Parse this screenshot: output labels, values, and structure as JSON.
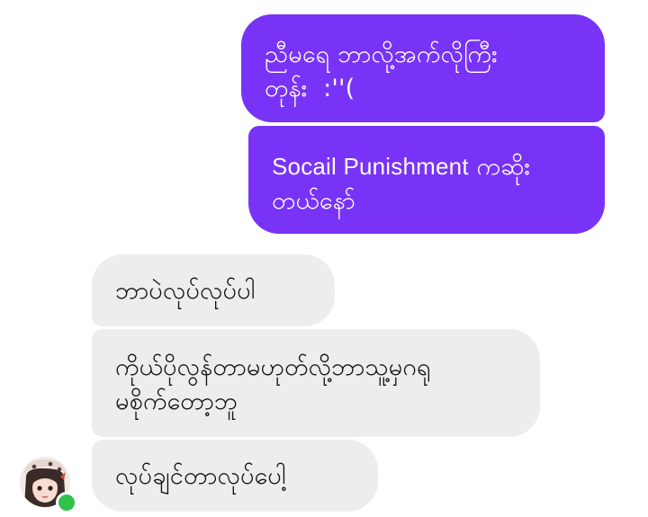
{
  "messages": [
    {
      "direction": "outgoing",
      "text": "ညီမရေ ဘာလို့အက်လိုကြီး\nတုန်း  :''("
    },
    {
      "direction": "outgoing",
      "latin": "Socail Punishment",
      "text": " ကဆိုး\nတယ်နော်"
    },
    {
      "direction": "incoming",
      "text": "ဘာပဲလုပ်လုပ်ပါ"
    },
    {
      "direction": "incoming",
      "text": "ကိုယ်ပိုလွန်တာမဟုတ်လို့ဘာသူ့မှဂရု\nမစိုက်တော့ဘူ"
    },
    {
      "direction": "incoming",
      "text": "လုပ်ချင်တာလုပ်ပေါ့"
    }
  ],
  "colors": {
    "outgoing_bubble": "#7833f7",
    "incoming_bubble": "#ededed",
    "online_indicator": "#31c24b"
  },
  "contact": {
    "avatar_icon": "profile-avatar",
    "online": true
  }
}
